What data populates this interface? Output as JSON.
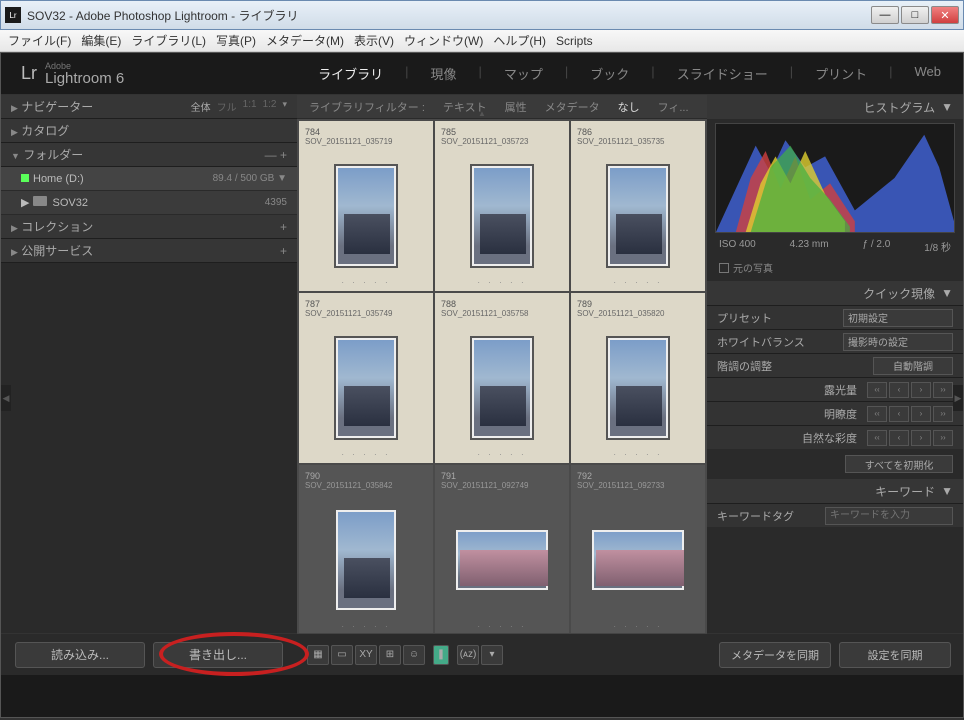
{
  "title": "SOV32 - Adobe Photoshop Lightroom - ライブラリ",
  "menubar": [
    "ファイル(F)",
    "編集(E)",
    "ライブラリ(L)",
    "写真(P)",
    "メタデータ(M)",
    "表示(V)",
    "ウィンドウ(W)",
    "ヘルプ(H)",
    "Scripts"
  ],
  "logo": {
    "brand": "Adobe",
    "product": "Lightroom 6",
    "mark": "Lr"
  },
  "modules": [
    "ライブラリ",
    "現像",
    "マップ",
    "ブック",
    "スライドショー",
    "プリント",
    "Web"
  ],
  "active_module": "ライブラリ",
  "left": {
    "navigator": {
      "label": "ナビゲーター",
      "opts": [
        "全体",
        "フル",
        "1:1",
        "1:2"
      ]
    },
    "catalog": "カタログ",
    "folders": {
      "label": "フォルダー",
      "drive": {
        "name": "Home (D:)",
        "usage": "89.4 / 500 GB"
      },
      "folder": {
        "name": "SOV32",
        "count": "4395"
      }
    },
    "collections": "コレクション",
    "publish": "公開サービス",
    "import_btn": "読み込み...",
    "export_btn": "書き出し..."
  },
  "filter": {
    "label": "ライブラリフィルター :",
    "tabs": [
      "テキスト",
      "属性",
      "メタデータ",
      "なし",
      "フィ..."
    ],
    "active": "なし"
  },
  "thumbs": [
    {
      "num": "784",
      "fname": "SOV_20151121_035719",
      "shape": "tall",
      "dark": false
    },
    {
      "num": "785",
      "fname": "SOV_20151121_035723",
      "shape": "tall",
      "dark": false
    },
    {
      "num": "786",
      "fname": "SOV_20151121_035735",
      "shape": "tall",
      "dark": false
    },
    {
      "num": "787",
      "fname": "SOV_20151121_035749",
      "shape": "tall",
      "dark": false
    },
    {
      "num": "788",
      "fname": "SOV_20151121_035758",
      "shape": "tall",
      "dark": false
    },
    {
      "num": "789",
      "fname": "SOV_20151121_035820",
      "shape": "tall",
      "dark": false
    },
    {
      "num": "790",
      "fname": "SOV_20151121_035842",
      "shape": "tall",
      "dark": true
    },
    {
      "num": "791",
      "fname": "SOV_20151121_092749",
      "shape": "wide",
      "dark": true
    },
    {
      "num": "792",
      "fname": "SOV_20151121_092733",
      "shape": "wide",
      "dark": true
    }
  ],
  "histo": {
    "label": "ヒストグラム",
    "iso": "ISO 400",
    "focal": "4.23 mm",
    "aperture": "ƒ / 2.0",
    "shutter": "1/8 秒",
    "original": "元の写真"
  },
  "quickdev": {
    "label": "クイック現像",
    "preset_lbl": "プリセット",
    "preset_val": "初期設定",
    "wb_lbl": "ホワイトバランス",
    "wb_val": "撮影時の設定",
    "tone_lbl": "階調の調整",
    "auto_btn": "自動階調",
    "exposure": "露光量",
    "clarity": "明瞭度",
    "vibrance": "自然な彩度",
    "reset": "すべてを初期化"
  },
  "keywords": {
    "label": "キーワード",
    "tag_lbl": "キーワードタグ",
    "placeholder": "キーワードを入力"
  },
  "right_bottom": {
    "sync_meta": "メタデータを同期",
    "sync_settings": "設定を同期"
  }
}
